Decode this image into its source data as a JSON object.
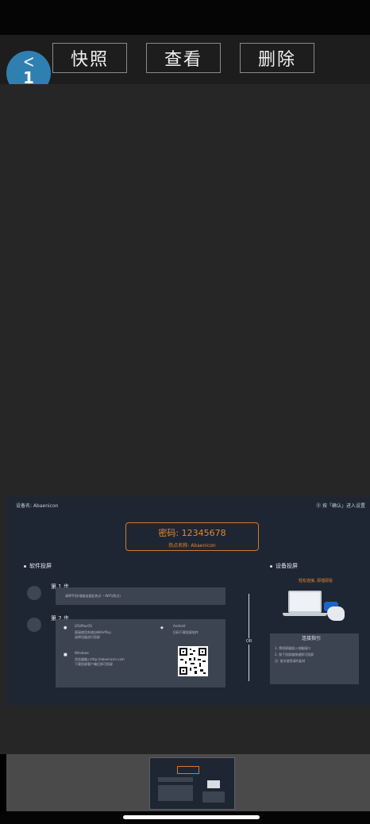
{
  "toolbar": {
    "snapshot_label": "快照",
    "view_label": "查看",
    "delete_label": "删除",
    "back_count": "1",
    "back_icon": "chevron-left-icon"
  },
  "projected_screen": {
    "device_name": "设备名: Abaenicon",
    "top_right": "⓪ 按「确认」进入设置",
    "password": "密码: 12345678",
    "hotspot": "热点名称: Abaenicon",
    "software_section": "软件投屏",
    "device_section": "设备投屏",
    "step1": "第 1 步",
    "step1_text": "请将手机/电脑连接此热点 —WiFi(热点)",
    "step2": "第 2 步",
    "mac_title": "iOS/MacOS",
    "mac_text1": "直接使用系统自带AirPlay",
    "mac_text2": "选择设备进行投屏",
    "windows_title": "Windows",
    "windows_text1": "浏览器输入http://abaenicon.com",
    "windows_text2": "下载投屏客户端后即可投屏",
    "android_title": "Android",
    "android_text": "扫码下载投屏软件",
    "or_label": "OR",
    "device_hint": "轻松连接, 即插即投",
    "intro_title": "连接指引",
    "intro_text1": "1. 将投屏器插入电脑接口",
    "intro_text2": "2. 按下投屏器按键即可投屏",
    "intro_text3": "注: 首次使用请先配对"
  },
  "colors": {
    "accent_orange": "#e8862e",
    "badge_blue": "#2f7fb1",
    "screen_bg": "#1e2633"
  }
}
